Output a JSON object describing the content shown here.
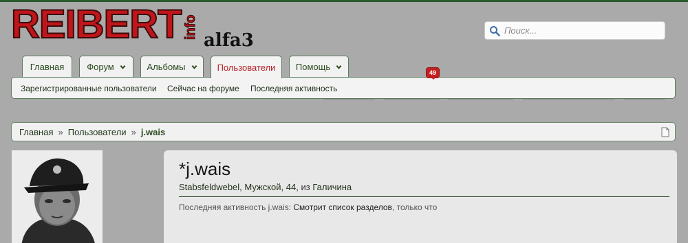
{
  "logo": {
    "main": "REIBERT",
    "info": "info",
    "sub": "alfa3"
  },
  "search": {
    "placeholder": "Поиск..."
  },
  "tabs": [
    {
      "label": "Главная"
    },
    {
      "label": "Форум"
    },
    {
      "label": "Альбомы"
    },
    {
      "label": "Пользователи"
    },
    {
      "label": "Помощь"
    }
  ],
  "subnav": [
    {
      "label": "Зарегистрированные пользователи"
    },
    {
      "label": "Сейчас на форуме"
    },
    {
      "label": "Последняя активность"
    }
  ],
  "badge": {
    "count": "49"
  },
  "breadcrumb": {
    "home": "Главная",
    "sep1": "»",
    "section": "Пользователи",
    "sep2": "»",
    "current": "j.wais"
  },
  "profile": {
    "username": "*j.wais",
    "rank": "Stabsfeldwebel, Мужской, 44,",
    "from_word": "из",
    "location": "Галичина",
    "activity_prefix": "Последняя активность j.wais:",
    "activity_action": "Смотрит список разделов",
    "activity_time": ", только что"
  },
  "colors": {
    "accent_red": "#c0161b",
    "nav_green": "#2a4a1e",
    "active_tab": "#b51f26"
  }
}
